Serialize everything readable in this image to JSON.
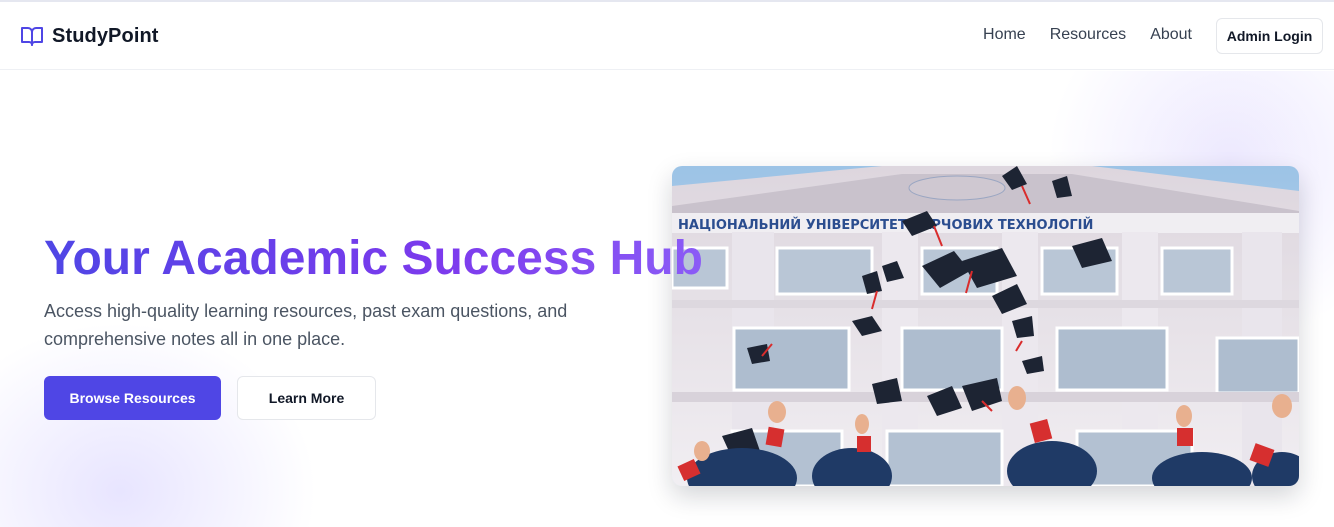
{
  "brand": {
    "name": "StudyPoint",
    "icon": "open-book-icon",
    "accent_color": "#4f46e5"
  },
  "nav": {
    "links": [
      {
        "label": "Home"
      },
      {
        "label": "Resources"
      },
      {
        "label": "About"
      }
    ],
    "admin_login": "Admin Login"
  },
  "hero": {
    "title": "Your Academic Success Hub",
    "subtitle": "Access high-quality learning resources, past exam questions, and comprehensive notes all in one place.",
    "primary_button": "Browse Resources",
    "secondary_button": "Learn More",
    "image": {
      "description_icon": "graduation-photo",
      "building_sign": "НАЦІОНАЛЬНИЙ УНІВЕРСИТЕТ ХАРЧОВИХ ТЕХНОЛОГІЙ"
    }
  }
}
